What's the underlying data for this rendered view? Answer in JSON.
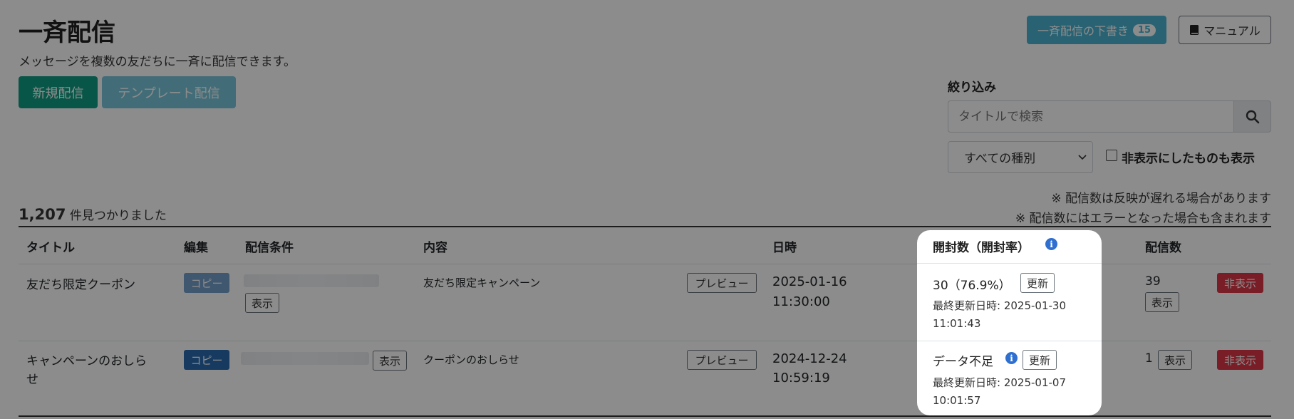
{
  "header": {
    "title": "一斉配信",
    "subtitle": "メッセージを複数の友だちに一斉に配信できます。",
    "new_button": "新規配信",
    "template_button": "テンプレート配信",
    "drafts_button": "一斉配信の下書き",
    "drafts_count": "15",
    "manual_button": "マニュアル"
  },
  "filter": {
    "heading": "絞り込み",
    "search_placeholder": "タイトルで検索",
    "type_select": "すべての種別",
    "show_hidden_label": "非表示にしたものも表示"
  },
  "notes": [
    "※ 配信数は反映が遅れる場合があります",
    "※ 配信数にはエラーとなった場合も含まれます"
  ],
  "results": {
    "count": "1,207",
    "suffix": "件見つかりました"
  },
  "table": {
    "headers": {
      "title": "タイトル",
      "edit": "編集",
      "condition": "配信条件",
      "content": "内容",
      "datetime": "日時",
      "open": "開封数（開封率）",
      "sent": "配信数"
    },
    "rows": [
      {
        "title": "友だち限定クーポン",
        "copy": "コピー",
        "show": "表示",
        "content": "友だち限定キャンペーン",
        "preview": "プレビュー",
        "date": "2025-01-16",
        "time": "11:30:00",
        "open_value": "30（76.9%）",
        "refresh": "更新",
        "updated_label": "最終更新日時: 2025-01-30",
        "updated_time": "11:01:43",
        "sent": "39",
        "sent_show": "表示",
        "hide": "非表示"
      },
      {
        "title_line1": "キャンペーンのおしら",
        "title_line2": "せ",
        "copy": "コピー",
        "show": "表示",
        "content": "クーポンのおしらせ",
        "preview": "プレビュー",
        "date": "2024-12-24",
        "time": "10:59:19",
        "open_value": "データ不足",
        "refresh": "更新",
        "updated_label": "最終更新日時: 2025-01-07",
        "updated_time": "10:01:57",
        "sent": "1",
        "sent_show": "表示",
        "hide": "非表示"
      }
    ]
  },
  "colors": {
    "primary_green": "#0f9d82",
    "info_blue": "#4cb3cf",
    "copy_blue": "#2b6cb0",
    "danger": "#dc3545"
  },
  "icons": {
    "search": "search-icon",
    "manual": "book-icon",
    "info": "info-icon",
    "dropdown": "chevron-down-icon"
  }
}
